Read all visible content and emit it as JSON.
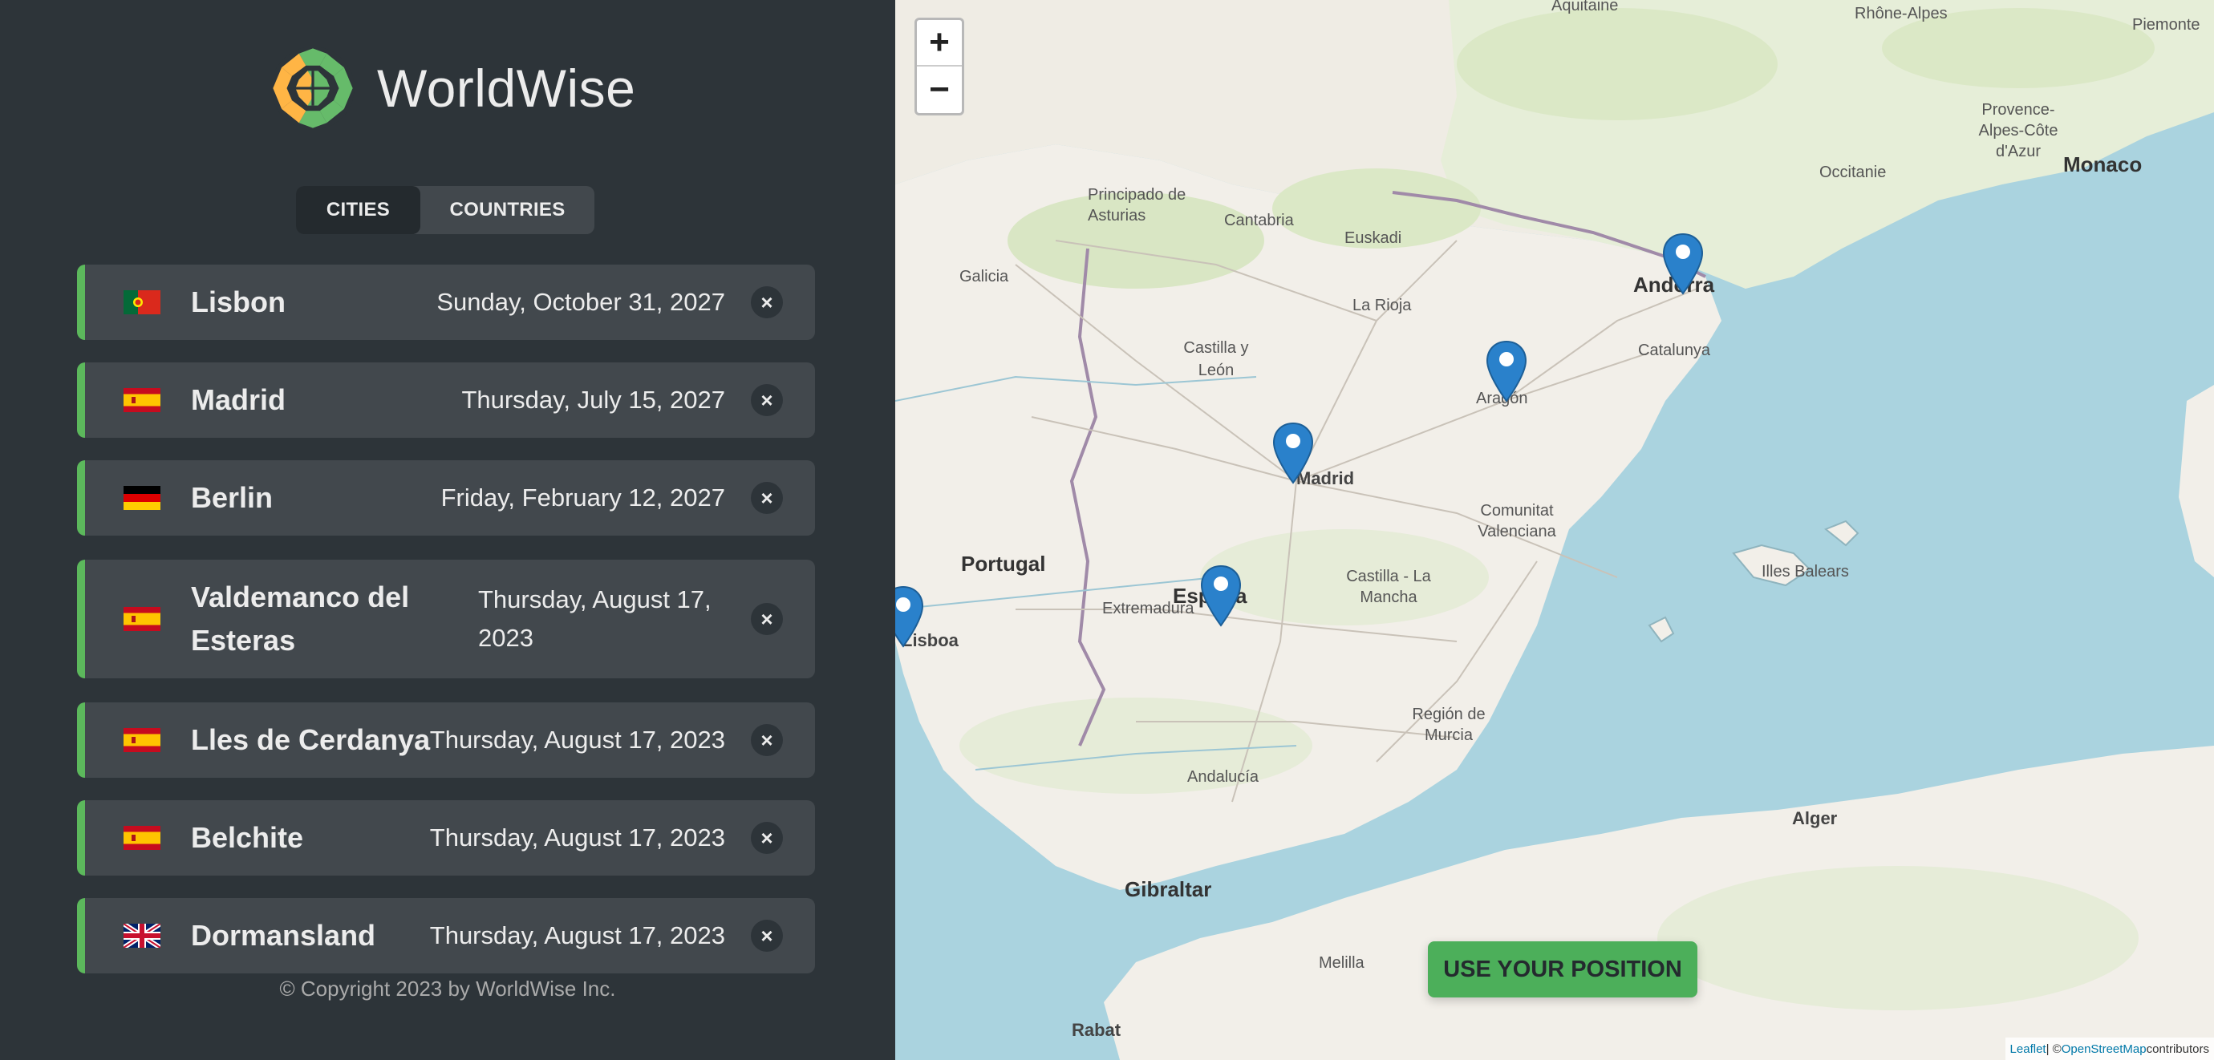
{
  "app": {
    "name": "WorldWise"
  },
  "tabs": {
    "cities": "CITIES",
    "countries": "COUNTRIES"
  },
  "cities": [
    {
      "flag": "portugal",
      "name": "Lisbon",
      "date": "Sunday, October 31, 2027"
    },
    {
      "flag": "spain",
      "name": "Madrid",
      "date": "Thursday, July 15, 2027"
    },
    {
      "flag": "germany",
      "name": "Berlin",
      "date": "Friday, February 12, 2027"
    },
    {
      "flag": "spain",
      "name": "Valdemanco del Esteras",
      "date": "Thursday, August 17, 2023"
    },
    {
      "flag": "spain",
      "name": "Lles de Cerdanya",
      "date": "Thursday, August 17, 2023"
    },
    {
      "flag": "spain",
      "name": "Belchite",
      "date": "Thursday, August 17, 2023"
    },
    {
      "flag": "uk",
      "name": "Dormansland",
      "date": "Thursday, August 17, 2023"
    }
  ],
  "delete_symbol": "×",
  "footer": {
    "copyright": "© Copyright 2023 by WorldWise Inc."
  },
  "map": {
    "zoom_in": "+",
    "zoom_out": "−",
    "use_position": "USE YOUR POSITION",
    "attribution": {
      "leaflet": "Leaflet",
      "separator": " | © ",
      "osm": "OpenStreetMap",
      "suffix": " contributors"
    },
    "labels": {
      "portugal": "Portugal",
      "madrid": "Madrid",
      "espana": "España",
      "lisboa": "Lisboa",
      "andorra": "Andorra",
      "monaco": "Monaco",
      "gibraltar": "Gibraltar",
      "alger": "Alger",
      "rabat": "Rabat",
      "melilla": "Melilla",
      "aquitaine": "Aquitaine",
      "rhone_alpes": "Rhône-Alpes",
      "piemonte": "Piemonte",
      "occitanie": "Occitanie",
      "provence": "Provence-Alpes-Côte d'Azur",
      "principado": "Principado de Asturias",
      "cantabria": "Cantabria",
      "euskadi": "Euskadi",
      "galicia": "Galicia",
      "la_rioja": "La Rioja",
      "castilla_leon": "Castilla y León",
      "aragon": "Aragón",
      "catalunya": "Catalunya",
      "extremadura": "Extremadura",
      "castilla_mancha": "Castilla - La Mancha",
      "comunitat": "Comunitat Valenciana",
      "illes_balears": "Illes Balears",
      "murcia": "Región de Murcia",
      "andalucia": "Andalucía"
    }
  },
  "colors": {
    "accent": "#5cb85c",
    "sidebar_bg": "#2d3439",
    "item_bg": "#42484d",
    "water": "#aad3df",
    "land": "#f2efe9",
    "marker": "#2a81cb"
  }
}
